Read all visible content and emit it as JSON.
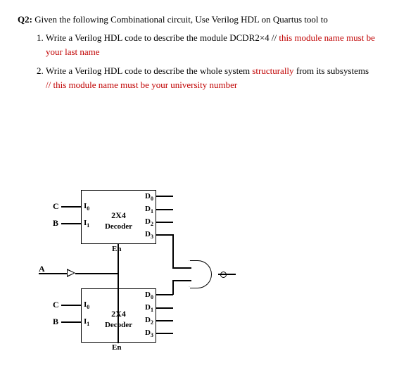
{
  "question": {
    "prefix": "Q2:",
    "text": "Given the following Combinational circuit, Use Verilog HDL on Quartus tool to"
  },
  "items": [
    {
      "num": "1.",
      "text": "Write a Verilog HDL code to describe the module DCDR2×4 //",
      "red": "this module name must be your last name"
    },
    {
      "num": "2.",
      "text": "Write a Verilog HDL code to describe the whole system",
      "red1": "structurally",
      "text2": " from its subsystems",
      "red2": "// this module name must be your university number"
    }
  ],
  "circuit": {
    "inputs": {
      "A": "A",
      "B": "B",
      "C": "C"
    },
    "decoder": {
      "title": "2X4 Decoder",
      "I0": "I",
      "I0s": "0",
      "I1": "I",
      "I1s": "1",
      "En": "En",
      "D0": "D",
      "D0s": "0",
      "D1": "D",
      "D1s": "1",
      "D2": "D",
      "D2s": "2",
      "D3": "D",
      "D3s": "3"
    }
  }
}
